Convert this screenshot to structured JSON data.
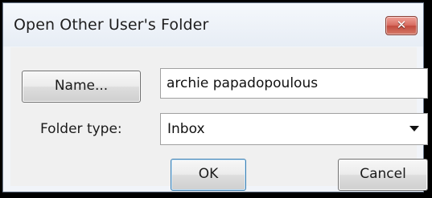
{
  "window": {
    "title": "Open Other User's Folder",
    "close_glyph": "✕"
  },
  "form": {
    "name_button_label": "Name...",
    "name_value": "archie papadopoulous",
    "folder_type_label": "Folder type:",
    "folder_type_value": "Inbox"
  },
  "buttons": {
    "ok_label": "OK",
    "cancel_label": "Cancel"
  },
  "icons": {
    "close": "close-icon",
    "dropdown": "chevron-down-icon"
  },
  "colors": {
    "close_button": "#d86d61",
    "dialog_background": "#f0f0f0",
    "title_background": "#eef2f8"
  }
}
